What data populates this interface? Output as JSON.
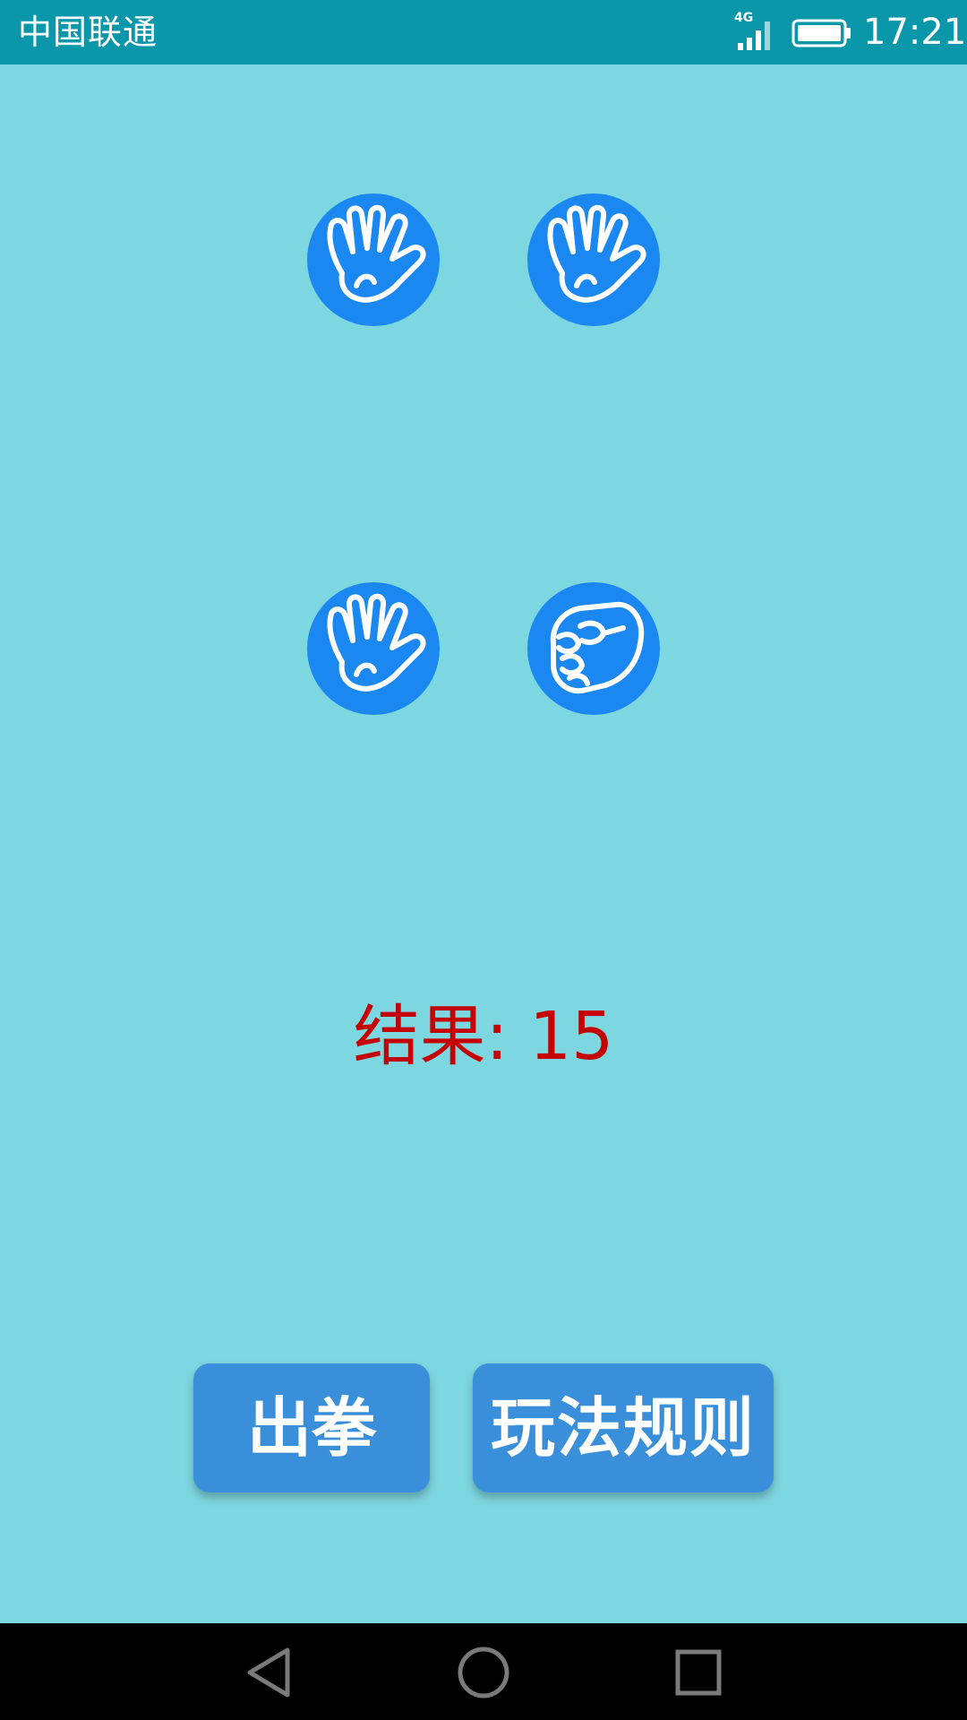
{
  "status_bar": {
    "carrier": "中国联通",
    "network": "4G",
    "time": "17:21"
  },
  "hands": [
    {
      "gesture": "paper",
      "icon": "paper-hand-icon"
    },
    {
      "gesture": "paper",
      "icon": "paper-hand-icon"
    },
    {
      "gesture": "paper",
      "icon": "paper-hand-icon"
    },
    {
      "gesture": "rock",
      "icon": "rock-fist-icon"
    }
  ],
  "result": {
    "text": "结果: 15"
  },
  "buttons": {
    "play_label": "出拳",
    "rules_label": "玩法规则"
  },
  "colors": {
    "background": "#7DD7E0",
    "status_bar": "#0A97A9",
    "button": "#398FD9",
    "result_text": "#C40404",
    "hand_circle": "#1A88F0"
  },
  "nav": {
    "back_icon": "back-triangle-icon",
    "home_icon": "home-circle-icon",
    "recents_icon": "recents-square-icon"
  }
}
